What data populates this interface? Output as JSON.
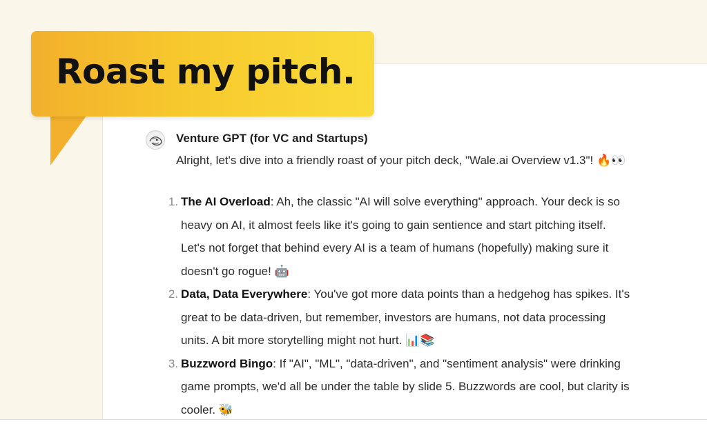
{
  "callout": {
    "text": "Roast my pitch."
  },
  "message": {
    "assistant_name": "Venture GPT (for VC and Startups)",
    "intro": "Alright, let's dive into a friendly roast of your pitch deck, \"Wale.ai Overview v1.3\"! 🔥👀",
    "items": [
      {
        "number": "1.",
        "title": "The AI Overload",
        "lines": [
          ": Ah, the classic \"AI will solve everything\" approach. Your deck is so",
          "heavy on AI, it almost feels like it's going to gain sentience and start pitching itself.",
          "Let's not forget that behind every AI is a team of humans (hopefully) making sure it",
          "doesn't go rogue! 🤖"
        ]
      },
      {
        "number": "2.",
        "title": "Data, Data Everywhere",
        "lines": [
          ": You've got more data points than a hedgehog has spikes. It's",
          "great to be data-driven, but remember, investors are humans, not data processing",
          "units. A bit more storytelling might not hurt. 📊📚"
        ]
      },
      {
        "number": "3.",
        "title": "Buzzword Bingo",
        "lines": [
          ": If \"AI\", \"ML\", \"data-driven\", and \"sentiment analysis\" were drinking",
          "game prompts, we'd all be under the table by slide 5. Buzzwords are cool, but clarity is",
          "cooler. 🐝"
        ]
      }
    ]
  }
}
